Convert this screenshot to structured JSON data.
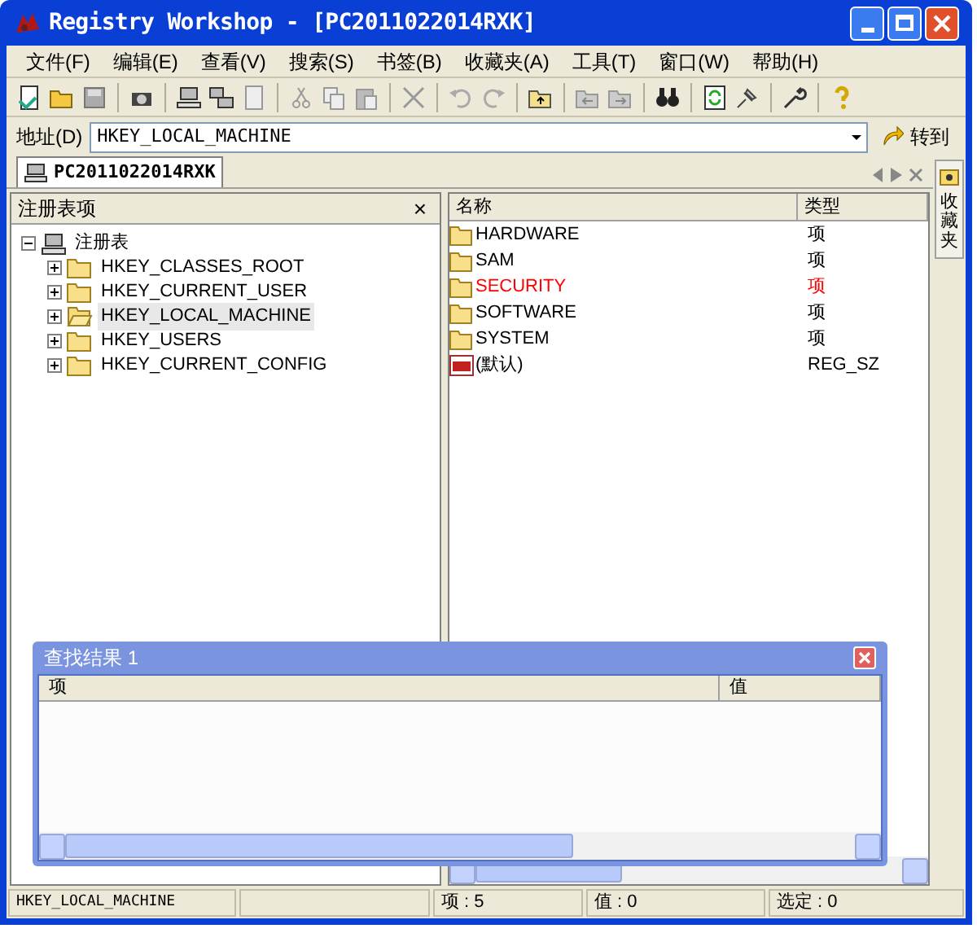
{
  "window": {
    "title": "Registry Workshop - [PC2011022014RXK]"
  },
  "menu": [
    "文件(F)",
    "编辑(E)",
    "查看(V)",
    "搜索(S)",
    "书签(B)",
    "收藏夹(A)",
    "工具(T)",
    "窗口(W)",
    "帮助(H)"
  ],
  "address": {
    "label": "地址(D)",
    "value": "HKEY_LOCAL_MACHINE",
    "go_button": "转到"
  },
  "tab": {
    "label": "PC2011022014RXK"
  },
  "side_tab": {
    "label": "收藏夹"
  },
  "tree_panel": {
    "title": "注册表项",
    "close": "×",
    "tree": [
      {
        "label": "注册表",
        "expanded": true,
        "selected": false,
        "children": [
          {
            "label": "HKEY_CLASSES_ROOT",
            "expanded": false,
            "selected": false
          },
          {
            "label": "HKEY_CURRENT_USER",
            "expanded": false,
            "selected": false
          },
          {
            "label": "HKEY_LOCAL_MACHINE",
            "expanded": false,
            "selected": true
          },
          {
            "label": "HKEY_USERS",
            "expanded": false,
            "selected": false
          },
          {
            "label": "HKEY_CURRENT_CONFIG",
            "expanded": false,
            "selected": false
          }
        ]
      }
    ]
  },
  "values_list": {
    "columns": [
      "名称",
      "类型"
    ],
    "rows": [
      {
        "kind": "folder",
        "name": "HARDWARE",
        "type": "项",
        "color": "#000000"
      },
      {
        "kind": "folder",
        "name": "SAM",
        "type": "项",
        "color": "#000000"
      },
      {
        "kind": "folder",
        "name": "SECURITY",
        "type": "项",
        "color": "#ff0000"
      },
      {
        "kind": "folder",
        "name": "SOFTWARE",
        "type": "项",
        "color": "#000000"
      },
      {
        "kind": "folder",
        "name": "SYSTEM",
        "type": "项",
        "color": "#000000"
      },
      {
        "kind": "string",
        "name": "(默认)",
        "type": "REG_SZ",
        "color": "#000000"
      }
    ]
  },
  "search_results": {
    "title": "查找结果 1",
    "columns": [
      "项",
      "值"
    ]
  },
  "status_bar": [
    "HKEY_LOCAL_MACHINE",
    "项 : 5",
    "值 : 0",
    "选定 : 0"
  ]
}
